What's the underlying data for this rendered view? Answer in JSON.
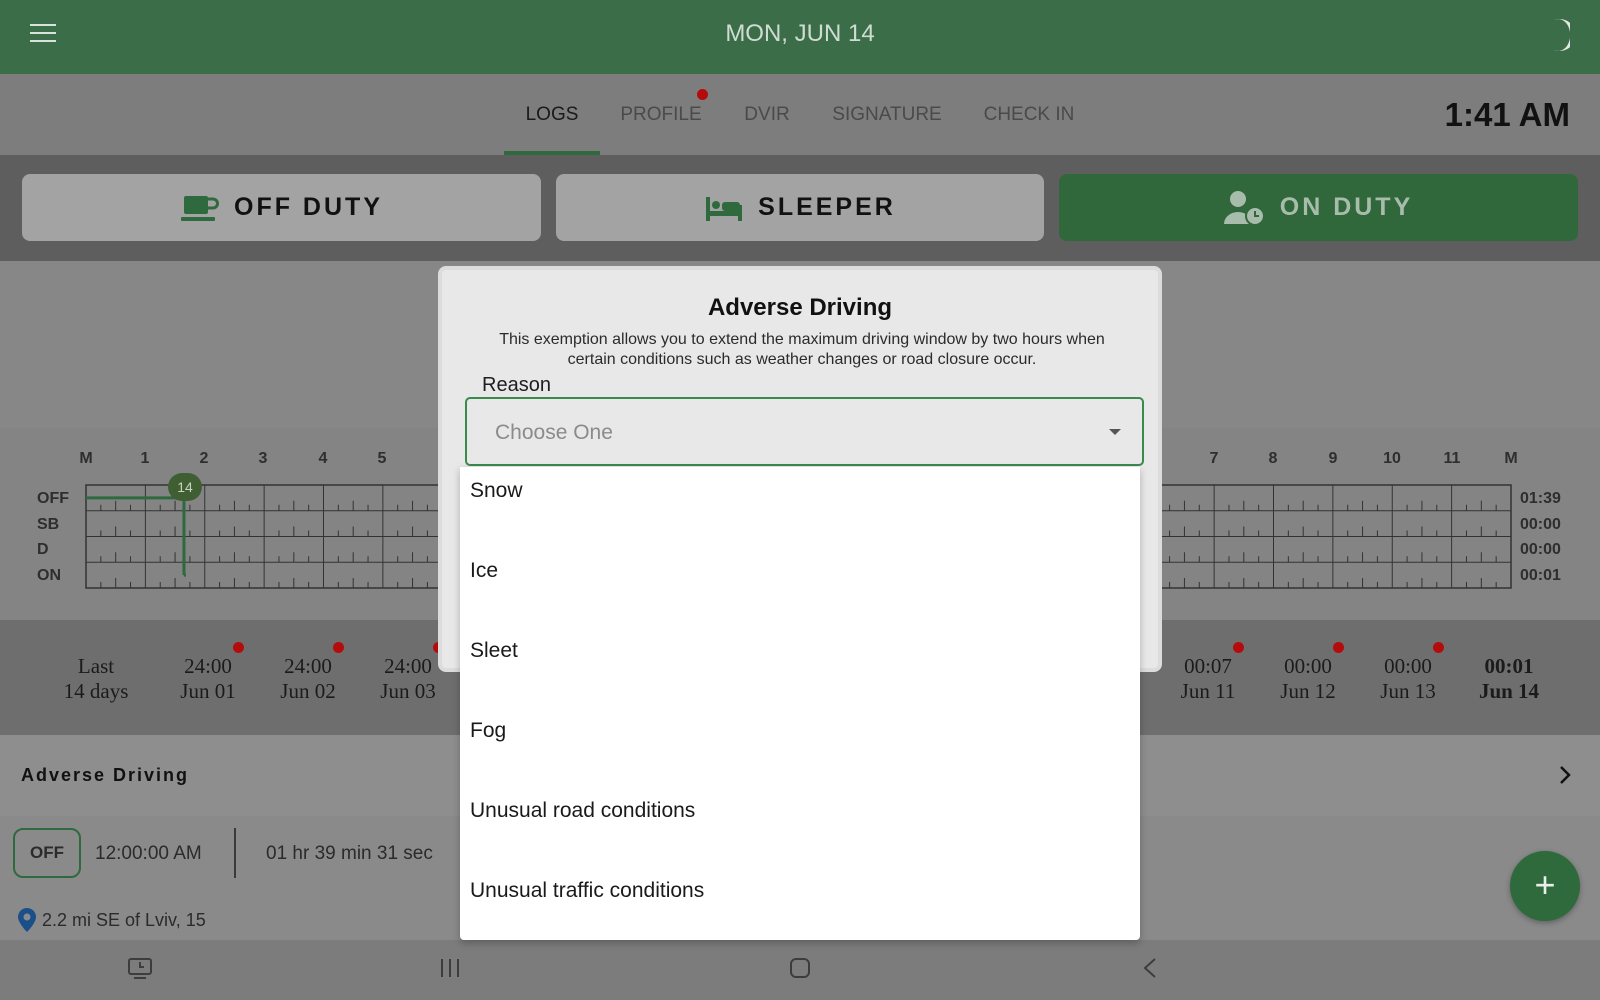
{
  "header": {
    "date": "MON, JUN 14",
    "menu_icon": "hamburger-menu-icon",
    "theme_icon": "moon-icon"
  },
  "tabs": [
    {
      "label": "LOGS",
      "active": true
    },
    {
      "label": "PROFILE",
      "has_notification": true
    },
    {
      "label": "DVIR"
    },
    {
      "label": "SIGNATURE"
    },
    {
      "label": "CHECK IN"
    }
  ],
  "clock": "1:41 AM",
  "status_buttons": {
    "off_duty": "OFF DUTY",
    "sleeper": "SLEEPER",
    "on_duty": "ON DUTY",
    "active": "on_duty"
  },
  "graph": {
    "hours_left": [
      "M",
      "1",
      "2",
      "3",
      "4",
      "5"
    ],
    "hours_right": [
      "7",
      "8",
      "9",
      "10",
      "11",
      "M"
    ],
    "rows": [
      "OFF",
      "SB",
      "D",
      "ON"
    ],
    "totals": [
      "01:39",
      "00:00",
      "00:00",
      "00:01"
    ],
    "marker": "14"
  },
  "days": {
    "last_label_line1": "Last",
    "last_label_line2": "14 days",
    "items": [
      {
        "hours": "24:00",
        "date": "Jun 01"
      },
      {
        "hours": "24:00",
        "date": "Jun 02"
      },
      {
        "hours": "24:00",
        "date": "Jun 03"
      },
      {
        "hours": "00:07",
        "date": "Jun 11"
      },
      {
        "hours": "00:00",
        "date": "Jun 12"
      },
      {
        "hours": "00:00",
        "date": "Jun 13"
      },
      {
        "hours": "00:01",
        "date": "Jun 14"
      }
    ]
  },
  "adverse_row": {
    "title": "Adverse Driving"
  },
  "log_entry": {
    "status": "OFF",
    "time": "12:00:00 AM",
    "duration": "01 hr 39 min 31 sec",
    "location": "2.2 mi SE of Lviv, 15"
  },
  "fab": "+",
  "dialog": {
    "title": "Adverse Driving",
    "description": "This exemption allows you to extend the maximum driving window by two hours when certain conditions such as weather changes or road closure occur.",
    "reason_label": "Reason",
    "select_placeholder": "Choose One",
    "options": [
      "Snow",
      "Ice",
      "Sleet",
      "Fog",
      "Unusual road conditions",
      "Unusual traffic conditions"
    ]
  },
  "colors": {
    "primary": "#3b6e48",
    "notification": "#b40c0c",
    "focus": "#3a8a4e"
  }
}
